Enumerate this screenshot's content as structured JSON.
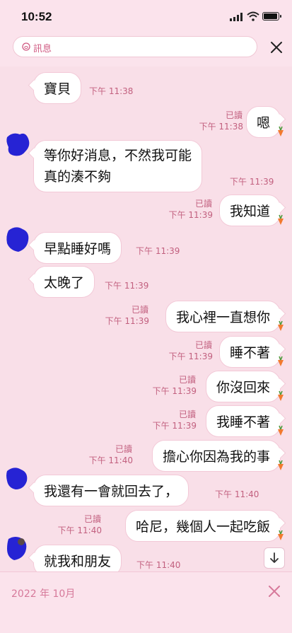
{
  "status": {
    "time": "10:52"
  },
  "search": {
    "placeholder": "訊息"
  },
  "messages": [
    {
      "side": "in",
      "text": "寶貝",
      "time": "下午 11:38"
    },
    {
      "side": "out",
      "text": "嗯",
      "read": "已讀",
      "time": "下午 11:38"
    },
    {
      "side": "in",
      "text": "等你好消息，不然我可能",
      "text2": "真的湊不夠",
      "time": "下午 11:39"
    },
    {
      "side": "out",
      "text": "我知道",
      "read": "已讀",
      "time": "下午 11:39"
    },
    {
      "side": "in",
      "text": "早點睡好嗎",
      "time": "下午 11:39"
    },
    {
      "side": "in",
      "text": "太晚了",
      "time": "下午 11:39"
    },
    {
      "side": "out",
      "text": "我心裡一直想你",
      "read": "已讀",
      "time": "下午 11:39"
    },
    {
      "side": "out",
      "text": "睡不著",
      "read": "已讀",
      "time": "下午 11:39"
    },
    {
      "side": "out",
      "text": "你沒回來",
      "read": "已讀",
      "time": "下午 11:39"
    },
    {
      "side": "out",
      "text": "我睡不著",
      "read": "已讀",
      "time": "下午 11:39"
    },
    {
      "side": "out",
      "text": "擔心你因為我的事",
      "read": "已讀",
      "time": "下午 11:40"
    },
    {
      "side": "in",
      "text": "我還有一會就回去了，",
      "time": "下午 11:40"
    },
    {
      "side": "out",
      "text": "哈尼，幾個人一起吃飯",
      "read": "已讀",
      "time": "下午 11:40"
    },
    {
      "side": "in",
      "text": "就我和朋友",
      "time": "下午 11:40"
    }
  ],
  "bottom": {
    "date": "2022 年 10月"
  },
  "colors": {
    "background": "#f9dfe8",
    "accent": "#d05a82",
    "bubble_border": "#f3c9d7"
  }
}
